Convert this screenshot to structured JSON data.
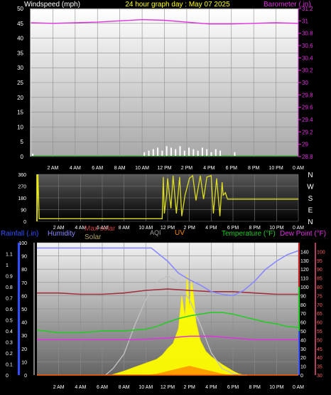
{
  "header": {
    "left": "Windspeed (mph)",
    "center": "24 hour graph day : May 07 2025",
    "right": "Barometer (.in)"
  },
  "x_ticks": [
    "2 AM",
    "4 AM",
    "6 AM",
    "8 AM",
    "10 AM",
    "12 PM",
    "2 PM",
    "4 PM",
    "6 PM",
    "8 PM",
    "10 PM",
    "0 AM"
  ],
  "colors": {
    "wind": "#ffffff",
    "barometer": "#e030e0",
    "direction": "#dddd22",
    "rain": "#3050ff",
    "humidity": "#8888ff",
    "max_solar": "#c0c0c0",
    "solar": "#ffff00",
    "uv": "#ff8800",
    "temperature": "#22cc22",
    "dew_point": "#e030e0",
    "aqi": "#a0a0a0"
  },
  "chart_data": [
    {
      "type": "line",
      "name": "wind-barometer",
      "x_range": [
        0,
        24
      ],
      "left_axis": {
        "label": "Windspeed (mph)",
        "ylim": [
          0,
          50
        ],
        "ticks": [
          0,
          5,
          10,
          15,
          20,
          25,
          30,
          35,
          40,
          45,
          50
        ]
      },
      "right_axis": {
        "label": "Barometer (.in)",
        "ylim": [
          28.8,
          31.2
        ],
        "ticks": [
          "28.8",
          "29",
          "29.2",
          "29.4",
          "29.6",
          "29.8",
          "30",
          "30.2",
          "30.4",
          "30.6",
          "30.8",
          "31",
          "31.2"
        ]
      },
      "series": [
        {
          "name": "Barometer",
          "axis": "right",
          "x": [
            0,
            2,
            4,
            6,
            8,
            10,
            12,
            14,
            16,
            18,
            20,
            22,
            24
          ],
          "y": [
            30.97,
            30.96,
            30.97,
            30.98,
            31.0,
            31.02,
            31.01,
            30.98,
            30.95,
            30.95,
            30.96,
            30.97,
            30.96
          ]
        },
        {
          "name": "Windspeed",
          "axis": "left",
          "x": [
            0.2,
            10.2,
            10.6,
            11.0,
            11.4,
            11.8,
            12.2,
            12.6,
            13.0,
            13.4,
            13.8,
            14.2,
            14.6,
            15.0,
            15.4,
            15.8,
            16.2,
            16.6,
            17.0,
            18.3
          ],
          "y": [
            1.0,
            1.5,
            2.0,
            2.5,
            3.0,
            2.0,
            3.5,
            3.0,
            2.5,
            3.5,
            2.0,
            3.0,
            2.5,
            2.0,
            3.0,
            2.5,
            1.5,
            2.5,
            2.0,
            1.5
          ]
        }
      ]
    },
    {
      "type": "line",
      "name": "wind-direction",
      "x_range": [
        0,
        24
      ],
      "ylim": [
        0,
        360
      ],
      "ticks": [
        0,
        90,
        180,
        270,
        360
      ],
      "compass": [
        "N",
        "W",
        "S",
        "E",
        "N"
      ],
      "series": [
        {
          "name": "Wind Direction",
          "x": [
            0,
            0.1,
            0.2,
            11.5,
            11.6,
            11.7,
            11.9,
            12.0,
            12.3,
            12.5,
            12.8,
            13.1,
            13.3,
            13.6,
            14.0,
            14.3,
            14.6,
            15.0,
            15.3,
            15.6,
            16.0,
            16.2,
            16.5,
            16.8,
            17.0,
            17.1,
            17.3,
            17.5,
            18.0,
            19.0,
            24.0
          ],
          "y": [
            0,
            360,
            20,
            20,
            340,
            60,
            200,
            330,
            100,
            350,
            60,
            340,
            40,
            200,
            330,
            350,
            160,
            350,
            170,
            340,
            350,
            60,
            330,
            40,
            300,
            200,
            220,
            170,
            170,
            170,
            170
          ]
        }
      ]
    },
    {
      "type": "line",
      "name": "weather-multi",
      "x_range": [
        0,
        24
      ],
      "axes": [
        {
          "label": "Rainfall (.in)",
          "ylim": [
            0,
            1.2
          ],
          "ticks": [
            "0",
            "0.1",
            "0.2",
            "0.3",
            "0.4",
            "0.5",
            "0.6",
            "0.7",
            "0.8",
            "0.9",
            "1",
            "1.1"
          ]
        },
        {
          "label": "Humidity",
          "ylim": [
            0,
            100
          ],
          "ticks": [
            0,
            10,
            20,
            30,
            40,
            50,
            60,
            70,
            80,
            90,
            100
          ]
        },
        {
          "label": "Temperature (°F)",
          "ylim": [
            0,
            150
          ],
          "ticks": [
            0,
            10,
            20,
            30,
            40,
            50,
            60,
            70,
            80,
            90,
            100,
            110,
            120,
            130,
            140
          ]
        },
        {
          "label": "Dew Point (°F)",
          "ylim": [
            30,
            105
          ],
          "ticks": [
            30,
            35,
            40,
            45,
            50,
            55,
            60,
            65,
            70,
            75,
            80,
            85,
            90,
            95,
            100
          ]
        }
      ],
      "legend": [
        "Rainfall (.in)",
        "Humidity",
        "Max solar",
        "Solar",
        "AQI",
        "UV",
        "Temperature (°F)",
        "Dew Point (°F)"
      ],
      "series": [
        {
          "name": "Humidity",
          "axis": "humidity",
          "x": [
            0,
            2,
            4,
            6,
            8,
            10,
            10.5,
            12,
            13,
            14,
            15,
            16,
            17,
            18,
            19,
            20,
            21,
            22,
            23,
            24
          ],
          "y": [
            96,
            96,
            96,
            96,
            96,
            96,
            96,
            86,
            77,
            72,
            68,
            63,
            61,
            60,
            64,
            71,
            80,
            86,
            91,
            94
          ]
        },
        {
          "name": "Temperature",
          "axis": "temperature",
          "x": [
            0,
            2,
            4,
            6,
            8,
            10,
            11,
            12,
            13,
            14,
            15,
            16,
            17,
            18,
            19,
            20,
            21,
            22,
            23,
            24
          ],
          "y": [
            51,
            48,
            48,
            50,
            50,
            52,
            55,
            60,
            64,
            67,
            69,
            71,
            71,
            69,
            66,
            63,
            60,
            58,
            55,
            54
          ]
        },
        {
          "name": "Dew Point",
          "axis": "dewpoint",
          "x": [
            0,
            3,
            6,
            9,
            12,
            14,
            16,
            18,
            20,
            22,
            24
          ],
          "y": [
            50,
            50,
            50,
            50,
            51,
            52,
            52,
            51,
            50,
            50,
            50
          ]
        },
        {
          "name": "Barometer trend",
          "axis": "humidity",
          "x": [
            0,
            2,
            4,
            6,
            8,
            10,
            12,
            14,
            16,
            17,
            18,
            20,
            22,
            24
          ],
          "y": [
            62,
            62,
            61,
            61,
            62,
            64,
            65,
            64,
            63,
            63,
            63,
            62,
            61,
            61
          ]
        },
        {
          "name": "Max solar",
          "axis": "humidity",
          "x": [
            6.3,
            7,
            8,
            9,
            10,
            11,
            12,
            13,
            14,
            15,
            16,
            17,
            18,
            18.5,
            19.3
          ],
          "y": [
            0,
            5,
            16,
            38,
            57,
            70,
            75,
            70,
            57,
            38,
            17,
            5,
            1,
            0,
            0
          ]
        },
        {
          "name": "Solar",
          "axis": "humidity",
          "x": [
            6.8,
            8,
            9,
            10,
            11,
            11.5,
            12,
            12.5,
            13,
            13.3,
            13.6,
            13.8,
            14,
            14.2,
            14.4,
            14.6,
            15,
            15.5,
            16,
            17,
            18,
            18.5,
            19
          ],
          "y": [
            0,
            3,
            6,
            9,
            12,
            15,
            20,
            24,
            35,
            60,
            44,
            76,
            50,
            72,
            58,
            40,
            26,
            18,
            14,
            8,
            3,
            1,
            0
          ]
        },
        {
          "name": "UV",
          "axis": "humidity",
          "x": [
            10,
            11,
            12,
            13,
            14,
            15,
            16,
            17,
            18
          ],
          "y": [
            0,
            1,
            3,
            5,
            7,
            5,
            3,
            1,
            0
          ]
        },
        {
          "name": "Rainfall",
          "axis": "rain",
          "x": [
            0,
            24
          ],
          "y": [
            0,
            0
          ]
        }
      ]
    }
  ]
}
